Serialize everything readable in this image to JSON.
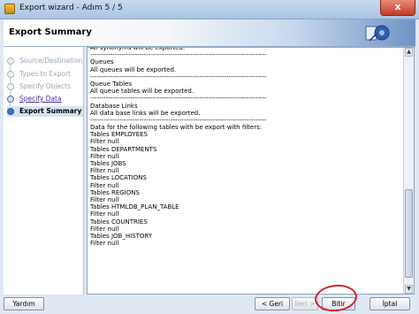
{
  "window": {
    "title": "Export wizard - Adım 5 / 5",
    "close_glyph": "x"
  },
  "header": {
    "title": "Export Summary"
  },
  "steps": [
    {
      "label": "Source/Destination",
      "state": "done"
    },
    {
      "label": "Types to Export",
      "state": "done"
    },
    {
      "label": "Specify Objects",
      "state": "done"
    },
    {
      "label": "Specify Data",
      "state": "link"
    },
    {
      "label": "Export Summary",
      "state": "current"
    }
  ],
  "summary_lines": [
    "All synonyms will be exported.",
    "-------------------------------------------------------------------------------",
    "Queues",
    "All queues will be exported.",
    "-------------------------------------------------------------------------------",
    "Queue Tables",
    "All queue tables will be exported.",
    "-------------------------------------------------------------------------------",
    "Database Links",
    "All data base links will be exported.",
    "-------------------------------------------------------------------------------",
    "Data for the following tables with be export with filters:",
    "Tables EMPLOYEES",
    "Filter null",
    "Tables DEPARTMENTS",
    "Filter null",
    "Tables JOBS",
    "Filter null",
    "Tables LOCATIONS",
    "Filter null",
    "Tables REGIONS",
    "Filter null",
    "Tables HTMLDB_PLAN_TABLE",
    "Filter null",
    "Tables COUNTRIES",
    "Filter null",
    "Tables JOB_HISTORY",
    "Filter null"
  ],
  "buttons": {
    "help": "Yardım",
    "back": "< Geri",
    "next": "İleri >",
    "finish": "Bitir",
    "cancel": "İptal"
  },
  "colors": {
    "annotation_circle": "#d6222a",
    "current_step": "#d6e3f5"
  }
}
